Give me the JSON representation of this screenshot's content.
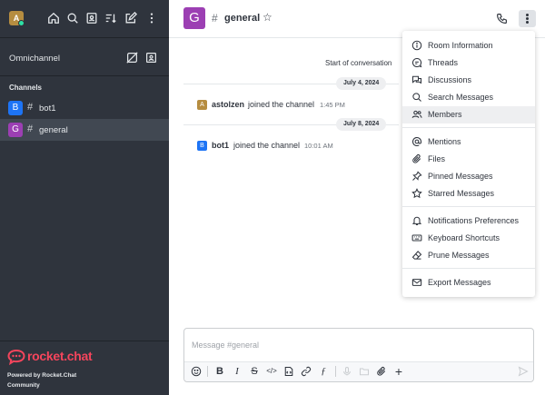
{
  "sidebar": {
    "user_avatar": "A",
    "omnichannel_label": "Omnichannel",
    "section_title": "Channels",
    "rooms": [
      {
        "avatar": "B",
        "name": "bot1",
        "color": "#1d74f5"
      },
      {
        "avatar": "G",
        "name": "general",
        "color": "#9c3fb3"
      }
    ],
    "brand": "rocket.chat",
    "powered_by": "Powered by Rocket.Chat",
    "edition": "Community"
  },
  "header": {
    "avatar": "G",
    "hash": "#",
    "room_name": "general",
    "star": "☆"
  },
  "messages": {
    "start_label": "Start of conversation",
    "date1": "July 4, 2024",
    "date2": "July 8, 2024",
    "items": [
      {
        "avatar": "A",
        "avatar_color": "#b68d40",
        "user": "astolzen",
        "text": "joined the channel",
        "time": "1:45 PM"
      },
      {
        "avatar": "B",
        "avatar_color": "#1d74f5",
        "user": "bot1",
        "text": "joined the channel",
        "time": "10:01 AM"
      }
    ]
  },
  "composer": {
    "placeholder": "Message #general"
  },
  "menu": {
    "items": [
      {
        "label": "Room Information",
        "icon": "info-icon"
      },
      {
        "label": "Threads",
        "icon": "threads-icon"
      },
      {
        "label": "Discussions",
        "icon": "discussions-icon"
      },
      {
        "label": "Search Messages",
        "icon": "search-icon"
      },
      {
        "label": "Members",
        "icon": "members-icon"
      },
      {
        "label": "Mentions",
        "icon": "at-icon"
      },
      {
        "label": "Files",
        "icon": "clip-icon"
      },
      {
        "label": "Pinned Messages",
        "icon": "pin-icon"
      },
      {
        "label": "Starred Messages",
        "icon": "star-icon"
      },
      {
        "label": "Notifications Preferences",
        "icon": "bell-icon"
      },
      {
        "label": "Keyboard Shortcuts",
        "icon": "keyboard-icon"
      },
      {
        "label": "Prune Messages",
        "icon": "eraser-icon"
      },
      {
        "label": "Export Messages",
        "icon": "mail-icon"
      }
    ]
  },
  "colors": {
    "sidebar_bg": "#2f343d",
    "brand_red": "#f5455c",
    "status_online": "#2de0a5"
  }
}
